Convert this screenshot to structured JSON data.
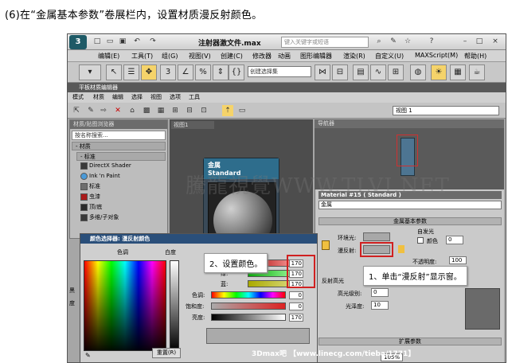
{
  "caption": "(6)在“金属基本参数”卷展栏内，设置材质漫反射颜色。",
  "titlebar": {
    "title": "注射器激文件.max",
    "search_placeholder": "键入关键字或短语"
  },
  "menubar": {
    "items": [
      "编辑(E)",
      "工具(T)",
      "组(G)",
      "视图(V)",
      "创建(C)",
      "修改器",
      "动画",
      "图形编辑器",
      "渲染(R)",
      "自定义(U)",
      "MAXScript(M)",
      "帮助(H)"
    ]
  },
  "toolbar": {
    "selection_set": "创建选择集"
  },
  "sme": {
    "title": "平板材质编辑器",
    "menu": [
      "模式",
      "材质",
      "编辑",
      "选择",
      "视图",
      "选项",
      "工具"
    ],
    "view_select": "视图 1"
  },
  "browser": {
    "header": "材质/贴图浏览器",
    "search": "按名称搜索...",
    "group": "- 材质",
    "subgroup": "- 标准",
    "items": [
      {
        "label": "DirectX Shader",
        "color": "#3a3a3a"
      },
      {
        "label": "Ink 'n Paint",
        "color": "#4a9ad8"
      },
      {
        "label": "标准",
        "color": "#6e6e6e"
      },
      {
        "label": "虫漆",
        "color": "#aa1a1a"
      },
      {
        "label": "顶/底",
        "color": "#2a2a2a"
      },
      {
        "label": "多维/子对象",
        "color": "#3a3a3a"
      }
    ]
  },
  "view": {
    "tab": "视图1",
    "node_title": "金属",
    "node_subtitle": "Standard"
  },
  "navigator": {
    "title": "导航器"
  },
  "props": {
    "material_title": "Material #15 ( Standard )",
    "material_name": "金属",
    "rollout_basic": "金属基本参数",
    "ambient_label": "环境光:",
    "diffuse_label": "漫反射:",
    "self_illum_label": "自发光",
    "color_label": "颜色",
    "color_value": "0",
    "opacity_label": "不透明度:",
    "opacity_value": "100",
    "specular_header": "反射高光",
    "spec_level_label": "高光级别:",
    "spec_level_value": "0",
    "gloss_label": "光泽度:",
    "gloss_value": "10",
    "rollout_ext": "扩展参数",
    "zoom": "105%"
  },
  "colorpicker": {
    "title": "颜色选择器: 漫反射颜色",
    "hue_label": "色调",
    "white_label": "白度",
    "black_label": "黑",
    "deg_label": "度",
    "channels": [
      {
        "label": "红:",
        "value": "170"
      },
      {
        "label": "绿:",
        "value": "170"
      },
      {
        "label": "蓝:",
        "value": "170"
      },
      {
        "label": "色调:",
        "value": "0"
      },
      {
        "label": "饱和度:",
        "value": "0"
      },
      {
        "label": "亮度:",
        "value": "170"
      }
    ],
    "reset": "重置(R)"
  },
  "annotations": {
    "step2": "2、设置颜色。",
    "step1": "1、单击“漫反射”显示窗。"
  },
  "watermark": {
    "text": "騰龍視覺WWW.TLVI.NET",
    "bottom": "3Dmax吧 【www.linecg.com/tieba/1771】"
  }
}
